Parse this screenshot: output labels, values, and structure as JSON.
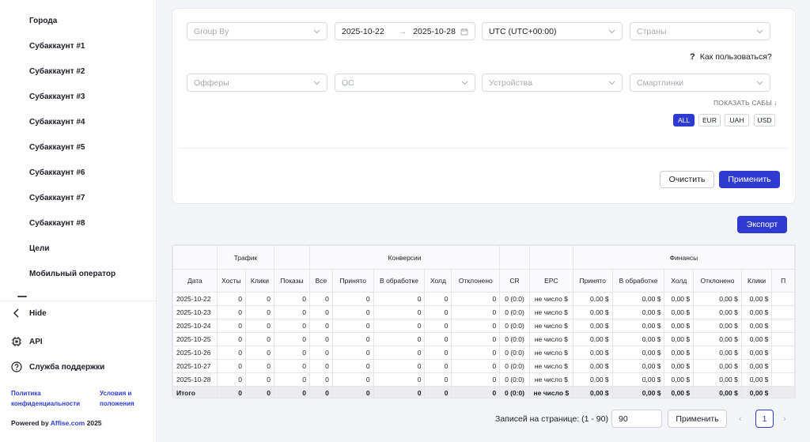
{
  "sidebar": {
    "items": [
      {
        "label": "Города"
      },
      {
        "label": "Субаккаунт #1"
      },
      {
        "label": "Субаккаунт #2"
      },
      {
        "label": "Субаккаунт #3"
      },
      {
        "label": "Субаккаунт #4"
      },
      {
        "label": "Субаккаунт #5"
      },
      {
        "label": "Субаккаунт #6"
      },
      {
        "label": "Субаккаунт #7"
      },
      {
        "label": "Субаккаунт #8"
      },
      {
        "label": "Цели"
      },
      {
        "label": "Мобильный оператор"
      }
    ],
    "hide_label": "Hide",
    "api_label": "API",
    "support_label": "Служба поддержки",
    "privacy_label_1": "Политика",
    "privacy_label_2": "конфиденциальности",
    "terms_label_1": "Условия и",
    "terms_label_2": "положения",
    "powered_prefix": "Powered by",
    "powered_brand": "Affise.com",
    "powered_year": "2025"
  },
  "filters": {
    "group_by_placeholder": "Group By",
    "date_from": "2025-10-22",
    "date_arrow": "→",
    "date_to": "2025-10-28",
    "timezone": "UTC (UTC+00:00)",
    "countries_placeholder": "Страны",
    "help_q": "?",
    "help_label": "Как пользоваться?",
    "offers_placeholder": "Офферы",
    "os_placeholder": "ОС",
    "devices_placeholder": "Устройства",
    "smartlinks_placeholder": "Смартлинки",
    "show_subs_label": "ПОКАЗАТЬ САБЫ ↓",
    "currencies": [
      "ALL",
      "EUR",
      "UAH",
      "USD"
    ],
    "active_currency": "ALL",
    "clear_label": "Очистить",
    "apply_label": "Применить"
  },
  "export_label": "Экспорт",
  "table": {
    "groups": {
      "traffic": "Трафик",
      "conversions": "Конверсии",
      "finances": "Финансы"
    },
    "columns": [
      "Дата",
      "Хосты",
      "Клики",
      "Показы",
      "Все",
      "Принято",
      "В обработке",
      "Холд",
      "Отклонено",
      "CR",
      "EPC",
      "Принято",
      "В обработке",
      "Холд",
      "Отклонено",
      "Клики",
      "П"
    ],
    "rows": [
      [
        "2025-10-22",
        "0",
        "0",
        "0",
        "0",
        "0",
        "0",
        "0",
        "0",
        "0 (0:0)",
        "не число $",
        "0,00 $",
        "0,00 $",
        "0,00 $",
        "0,00 $",
        "0,00 $",
        ""
      ],
      [
        "2025-10-23",
        "0",
        "0",
        "0",
        "0",
        "0",
        "0",
        "0",
        "0",
        "0 (0:0)",
        "не число $",
        "0,00 $",
        "0,00 $",
        "0,00 $",
        "0,00 $",
        "0,00 $",
        ""
      ],
      [
        "2025-10-24",
        "0",
        "0",
        "0",
        "0",
        "0",
        "0",
        "0",
        "0",
        "0 (0:0)",
        "не число $",
        "0,00 $",
        "0,00 $",
        "0,00 $",
        "0,00 $",
        "0,00 $",
        ""
      ],
      [
        "2025-10-25",
        "0",
        "0",
        "0",
        "0",
        "0",
        "0",
        "0",
        "0",
        "0 (0:0)",
        "не число $",
        "0,00 $",
        "0,00 $",
        "0,00 $",
        "0,00 $",
        "0,00 $",
        ""
      ],
      [
        "2025-10-26",
        "0",
        "0",
        "0",
        "0",
        "0",
        "0",
        "0",
        "0",
        "0 (0:0)",
        "не число $",
        "0,00 $",
        "0,00 $",
        "0,00 $",
        "0,00 $",
        "0,00 $",
        ""
      ],
      [
        "2025-10-27",
        "0",
        "0",
        "0",
        "0",
        "0",
        "0",
        "0",
        "0",
        "0 (0:0)",
        "не число $",
        "0,00 $",
        "0,00 $",
        "0,00 $",
        "0,00 $",
        "0,00 $",
        ""
      ],
      [
        "2025-10-28",
        "0",
        "0",
        "0",
        "0",
        "0",
        "0",
        "0",
        "0",
        "0 (0:0)",
        "не число $",
        "0,00 $",
        "0,00 $",
        "0,00 $",
        "0,00 $",
        "0,00 $",
        ""
      ]
    ],
    "total": [
      "Итого",
      "0",
      "0",
      "0",
      "0",
      "0",
      "0",
      "0",
      "0",
      "0 (0:0)",
      "не число $",
      "0,00 $",
      "0,00 $",
      "0,00 $",
      "0,00 $",
      "0,00 $",
      ""
    ]
  },
  "pagination": {
    "label": "Записей на странице: (1 - 90)",
    "per_page": "90",
    "apply_label": "Применить",
    "prev": "‹",
    "next": "›",
    "current_page": "1"
  },
  "colors": {
    "accent": "#2f3bd0",
    "link": "#2f3bd0"
  }
}
